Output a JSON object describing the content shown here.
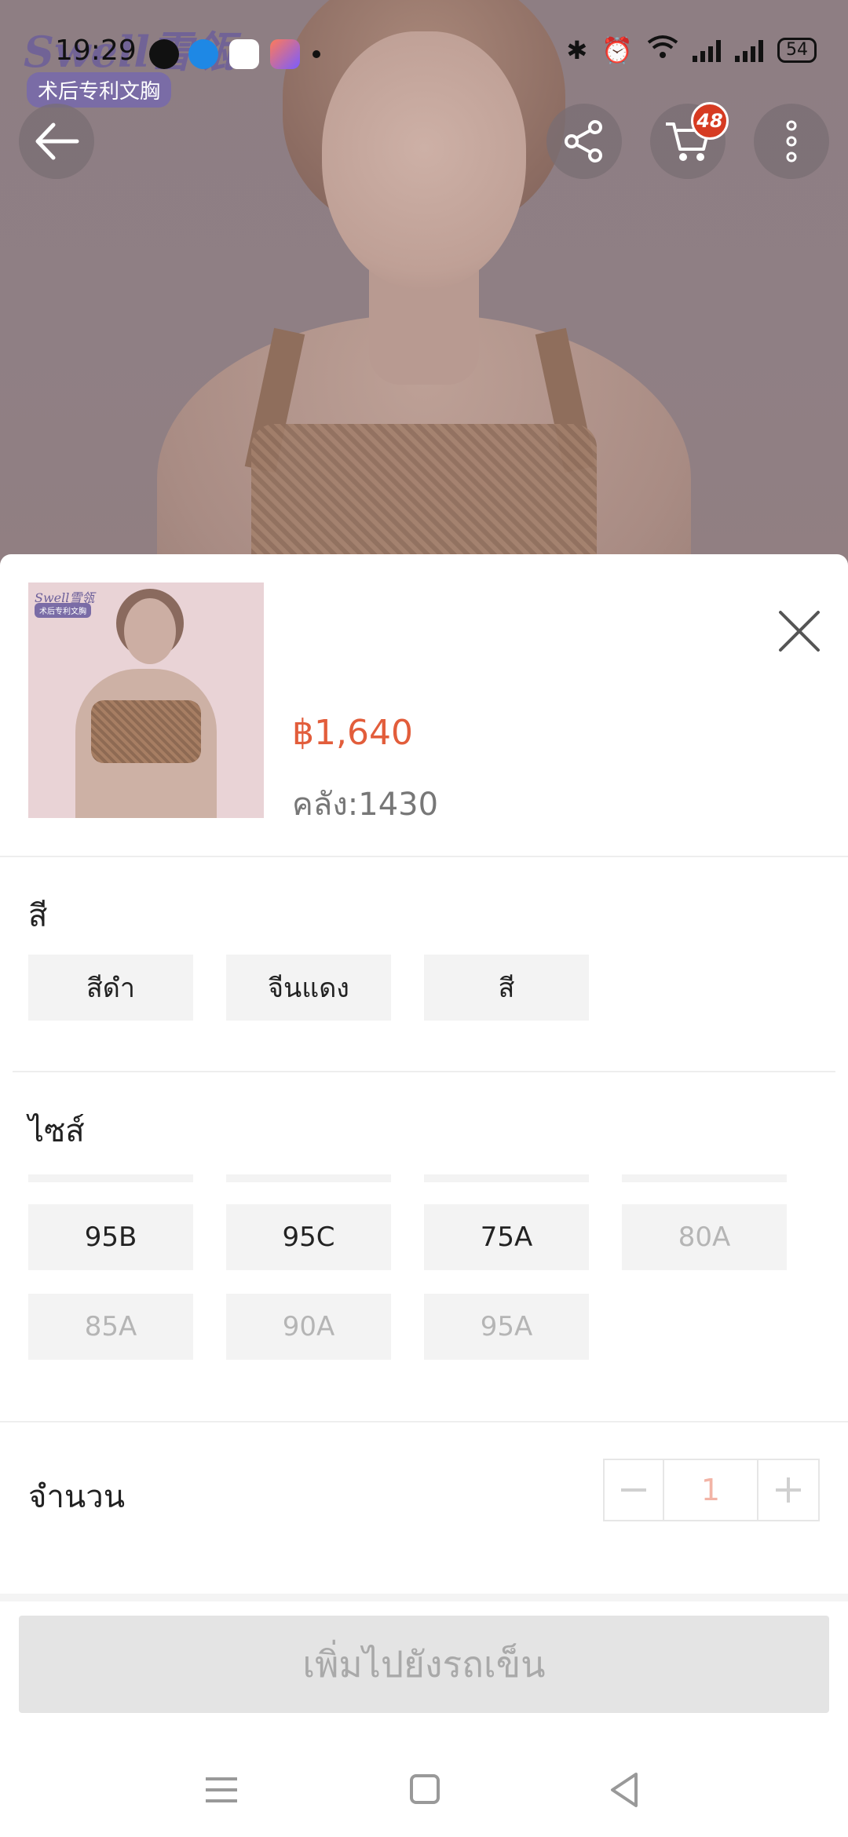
{
  "status_bar": {
    "time": "19:29",
    "battery": "54",
    "icons": [
      "line-icon",
      "browser-icon",
      "game-icon",
      "shortcut-icon",
      "bluetooth-icon",
      "alarm-icon",
      "wifi-icon",
      "signal-icon"
    ]
  },
  "hero": {
    "logo_text": "Swell雪瓴",
    "logo_tag": "术后专利文胸",
    "cart_count": "48"
  },
  "product": {
    "price": "฿1,640",
    "stock": "คลัง:1430"
  },
  "color_section": {
    "title": "สี",
    "options": [
      "สีดำ",
      "จีนแดง",
      "สี"
    ]
  },
  "size_section": {
    "title": "ไซส์",
    "options": [
      {
        "label": "95B",
        "available": true
      },
      {
        "label": "95C",
        "available": true
      },
      {
        "label": "75A",
        "available": true
      },
      {
        "label": "80A",
        "available": false
      },
      {
        "label": "85A",
        "available": false
      },
      {
        "label": "90A",
        "available": false
      },
      {
        "label": "95A",
        "available": false
      }
    ]
  },
  "quantity": {
    "title": "จำนวน",
    "value": "1"
  },
  "add_to_cart_label": "เพิ่มไปยังรถเข็น",
  "colors": {
    "price": "#e25d3b",
    "badge": "#d63b22",
    "chip_bg": "#f3f3f3",
    "disabled_text": "#b5b5b5"
  }
}
